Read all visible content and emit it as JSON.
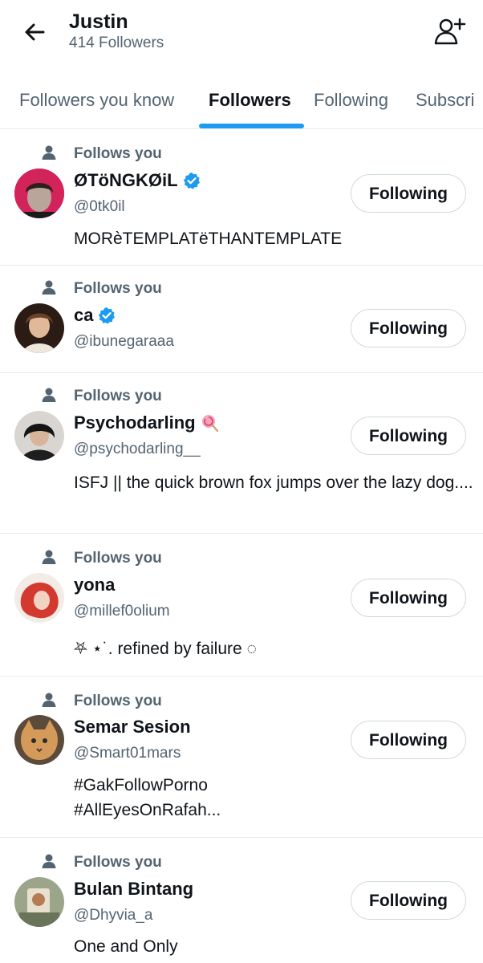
{
  "header": {
    "title": "Justin",
    "subtitle": "414 Followers",
    "back_icon": "arrow-left-icon",
    "add_user_icon": "add-user-icon"
  },
  "tabs": [
    {
      "label": "Followers you know",
      "active": false
    },
    {
      "label": "Followers",
      "active": true
    },
    {
      "label": "Following",
      "active": false
    },
    {
      "label": "Subscri",
      "active": false
    }
  ],
  "colors": {
    "accent": "#1d9bf0",
    "secondary_text": "#536471",
    "primary_text": "#0f1419",
    "divider": "#e6ecf0"
  },
  "followers": [
    {
      "follows_label": "Follows you",
      "name": "ØTöNGKØiL",
      "verified": true,
      "handle": "@0tk0il",
      "bio": "MORèTEMPLATëTHANTEMPLATE",
      "button": "Following",
      "avatar_color": "#d2245a"
    },
    {
      "follows_label": "Follows you",
      "name": "ca",
      "verified": true,
      "handle": "@ibunegaraaa",
      "bio": "",
      "button": "Following",
      "avatar_color": "#8a5a3c"
    },
    {
      "follows_label": "Follows you",
      "name": "Psychodarling",
      "verified": false,
      "emoji": "lollipop-icon",
      "handle": "@psychodarling__",
      "bio": "ISFJ  ||  the quick brown fox jumps over the lazy dog....",
      "button": "Following",
      "avatar_color": "#3a3f46"
    },
    {
      "follows_label": "Follows you",
      "name": "yona",
      "verified": false,
      "handle": "@millef0olium",
      "bio": "⛧ ⋆˙. refined by failure ◌",
      "button": "Following",
      "avatar_color": "#d33a2f"
    },
    {
      "follows_label": "Follows you",
      "name": "Semar Sesion",
      "verified": false,
      "handle": "@Smart01mars",
      "bio": "#GakFollowPorno\n#AllEyesOnRafah...",
      "button": "Following",
      "avatar_color": "#c88b4a"
    },
    {
      "follows_label": "Follows you",
      "name": "Bulan Bintang",
      "verified": false,
      "handle": "@Dhyvia_a",
      "bio": "One and Only",
      "button": "Following",
      "avatar_color": "#7c8a6a"
    }
  ]
}
